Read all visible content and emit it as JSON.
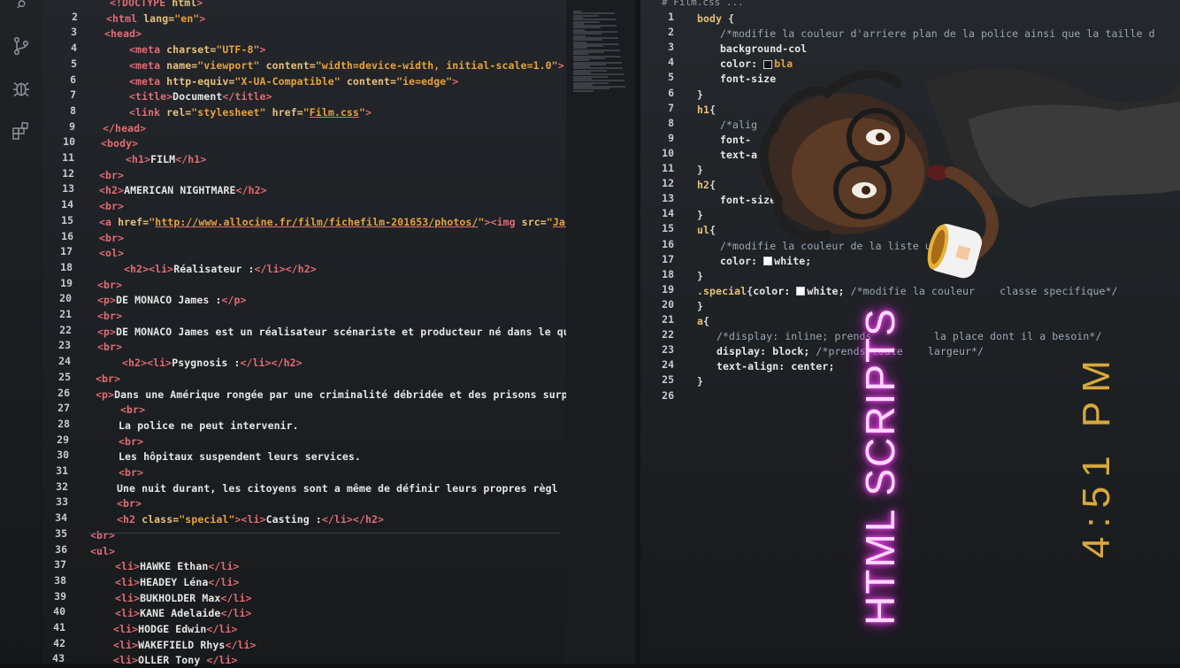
{
  "left_editor": {
    "lines": [
      {
        "n": "",
        "html": "<span class='tok-tag'>&lt;!DOCTYPE</span> <span class='tok-attr'>html</span><span class='tok-tag'>&gt;</span>",
        "indent": 124
      },
      {
        "n": "2",
        "html": "<span class='tok-tag'>&lt;html</span> <span class='tok-attr'>lang=</span><span class='tok-str'>\"en\"</span><span class='tok-tag'>&gt;</span>",
        "indent": 120
      },
      {
        "n": "3",
        "html": "<span class='tok-tag'>&lt;head&gt;</span>",
        "indent": 118
      },
      {
        "n": "4",
        "html": "<span class='tok-tag'>&lt;meta</span> <span class='tok-attr'>charset=</span><span class='tok-str'>\"UTF-8\"</span><span class='tok-tag'>&gt;</span>",
        "indent": 146
      },
      {
        "n": "5",
        "html": "<span class='tok-tag'>&lt;meta</span> <span class='tok-attr'>name=</span><span class='tok-str'>\"viewport\"</span> <span class='tok-attr'>content=</span><span class='tok-str'>\"width=device-width, initial-scale=1.0\"</span><span class='tok-tag'>&gt;</span>",
        "indent": 146
      },
      {
        "n": "6",
        "html": "<span class='tok-tag'>&lt;meta</span> <span class='tok-attr'>http-equiv=</span><span class='tok-str'>\"X-UA-Compatible\"</span> <span class='tok-attr'>content=</span><span class='tok-str'>\"ie=edge\"</span><span class='tok-tag'>&gt;</span>",
        "indent": 146
      },
      {
        "n": "7",
        "html": "<span class='tok-tag'>&lt;title&gt;</span><span class='tok-text'>Document</span><span class='tok-tag'>&lt;/title&gt;</span>",
        "indent": 146
      },
      {
        "n": "8",
        "html": "<span class='tok-tag'>&lt;link</span> <span class='tok-attr'>rel=</span><span class='tok-str'>\"stylesheet\"</span> <span class='tok-attr'>href=</span><span class='tok-str'>\"<span class='tok-link'>Film.css</span>\"</span><span class='tok-tag'>&gt;</span>",
        "indent": 146
      },
      {
        "n": "9",
        "html": "<span class='tok-tag'>&lt;/head&gt;</span>",
        "indent": 116
      },
      {
        "n": "10",
        "html": "<span class='tok-tag'>&lt;body&gt;</span>",
        "indent": 114
      },
      {
        "n": "11",
        "html": "<span class='tok-tag'>&lt;h1&gt;</span><span class='tok-text'>FILM</span><span class='tok-tag'>&lt;/h1&gt;</span>",
        "indent": 142
      },
      {
        "n": "12",
        "html": "<span class='tok-tag'>&lt;br&gt;</span>",
        "indent": 112
      },
      {
        "n": "13",
        "html": "<span class='tok-tag'>&lt;h2&gt;</span><span class='tok-text'>AMERICAN NIGHTMARE</span><span class='tok-tag'>&lt;/h2&gt;</span>",
        "indent": 112
      },
      {
        "n": "14",
        "html": "<span class='tok-tag'>&lt;br&gt;</span>",
        "indent": 112
      },
      {
        "n": "15",
        "html": "<span class='tok-tag'>&lt;a</span> <span class='tok-attr'>href=</span><span class='tok-str'>\"<span class='tok-link'>http://www.allocine.fr/film/fichefilm-201653/photos/</span>\"</span><span class='tok-tag'>&gt;&lt;img</span> <span class='tok-attr'>src=</span><span class='tok-str'>\"<span class='tok-link'>Jac</span></span>",
        "indent": 112
      },
      {
        "n": "16",
        "html": "<span class='tok-tag'>&lt;br&gt;</span>",
        "indent": 112
      },
      {
        "n": "17",
        "html": "<span class='tok-tag'>&lt;ol&gt;</span>",
        "indent": 112
      },
      {
        "n": "18",
        "html": "<span class='tok-tag'>&lt;h2&gt;&lt;li&gt;</span><span class='tok-text'>Réalisateur :</span><span class='tok-tag'>&lt;/li&gt;&lt;/h2&gt;</span>",
        "indent": 140
      },
      {
        "n": "19",
        "html": "<span class='tok-tag'>&lt;br&gt;</span>",
        "indent": 110
      },
      {
        "n": "20",
        "html": "<span class='tok-tag'>&lt;p&gt;</span><span class='tok-text'>DE MONACO James :</span><span class='tok-tag'>&lt;/p&gt;</span>",
        "indent": 110
      },
      {
        "n": "21",
        "html": "<span class='tok-tag'>&lt;br&gt;</span>",
        "indent": 110
      },
      {
        "n": "22",
        "html": "<span class='tok-tag'>&lt;p&gt;</span><span class='tok-text'>DE MONACO James est un réalisateur scénariste et producteur né dans le qu</span>",
        "indent": 110
      },
      {
        "n": "23",
        "html": "<span class='tok-tag'>&lt;br&gt;</span>",
        "indent": 110
      },
      {
        "n": "24",
        "html": "<span class='tok-tag'>&lt;h2&gt;&lt;li&gt;</span><span class='tok-text'>Psygnosis :</span><span class='tok-tag'>&lt;/li&gt;&lt;/h2&gt;</span>",
        "indent": 138
      },
      {
        "n": "25",
        "html": "<span class='tok-tag'>&lt;br&gt;</span>",
        "indent": 108
      },
      {
        "n": "26",
        "html": "<span class='tok-tag'>&lt;p&gt;</span><span class='tok-text'>Dans une Amérique rongée par une criminalité débridée et des prisons surp</span>",
        "indent": 108
      },
      {
        "n": "27",
        "html": "<span class='tok-tag'>&lt;br&gt;</span>",
        "indent": 136
      },
      {
        "n": "28",
        "html": "<span class='tok-text'>La police ne peut intervenir.</span>",
        "indent": 134
      },
      {
        "n": "29",
        "html": "<span class='tok-tag'>&lt;br&gt;</span>",
        "indent": 134
      },
      {
        "n": "30",
        "html": "<span class='tok-text'>Les hôpitaux suspendent leurs services.</span>",
        "indent": 134
      },
      {
        "n": "31",
        "html": "<span class='tok-tag'>&lt;br&gt;</span>",
        "indent": 134
      },
      {
        "n": "32",
        "html": "<span class='tok-text'>Une nuit durant, les citoyens sont a même de définir leurs propres règl</span>",
        "indent": 132
      },
      {
        "n": "33",
        "html": "<span class='tok-tag'>&lt;br&gt;</span>",
        "indent": 132
      },
      {
        "n": "34",
        "html": "<span class='tok-tag'>&lt;h2</span> <span class='tok-attr'>class=</span><span class='tok-str'>\"special\"</span><span class='tok-tag'>&gt;&lt;li&gt;</span><span class='tok-text'>Casting :</span><span class='tok-tag'>&lt;/li&gt;&lt;/h2&gt;</span>",
        "indent": 132
      },
      {
        "n": "35",
        "html": "<span class='tok-tag'>&lt;br&gt;</span>",
        "indent": 102
      },
      {
        "n": "36",
        "html": "<span class='tok-tag'>&lt;ul&gt;</span>",
        "indent": 102
      },
      {
        "n": "37",
        "html": "<span class='tok-tag'>&lt;li&gt;</span><span class='tok-text'>HAWKE Ethan</span><span class='tok-tag'>&lt;/li&gt;</span>",
        "indent": 130
      },
      {
        "n": "38",
        "html": "<span class='tok-tag'>&lt;li&gt;</span><span class='tok-text'>HEADEY Léna</span><span class='tok-tag'>&lt;/li&gt;</span>",
        "indent": 130
      },
      {
        "n": "39",
        "html": "<span class='tok-tag'>&lt;li&gt;</span><span class='tok-text'>BUKHOLDER Max</span><span class='tok-tag'>&lt;/li&gt;</span>",
        "indent": 130
      },
      {
        "n": "40",
        "html": "<span class='tok-tag'>&lt;li&gt;</span><span class='tok-text'>KANE Adelaide</span><span class='tok-tag'>&lt;/li&gt;</span>",
        "indent": 130
      },
      {
        "n": "41",
        "html": "<span class='tok-tag'>&lt;li&gt;</span><span class='tok-text'>HODGE Edwin</span><span class='tok-tag'>&lt;/li&gt;</span>",
        "indent": 128
      },
      {
        "n": "42",
        "html": "<span class='tok-tag'>&lt;li&gt;</span><span class='tok-text'>WAKEFIELD Rhys</span><span class='tok-tag'>&lt;/li&gt;</span>",
        "indent": 128
      },
      {
        "n": "43",
        "html": "<span class='tok-tag'>&lt;li&gt;</span><span class='tok-text'>OLLER Tony </span><span class='tok-tag'>&lt;/li&gt;</span>",
        "indent": 128
      }
    ]
  },
  "right_editor": {
    "tab_title": "#  Film.css   ...",
    "lines": [
      {
        "n": "1",
        "html": "<span class='tok-sel'>body</span> <span class='tok-punct'>{</span>",
        "indent": 788
      },
      {
        "n": "2",
        "html": "<span class='tok-comment'>/*modifie la couleur d'arriere plan de la police ainsi que la taille d</span>",
        "indent": 814
      },
      {
        "n": "3",
        "html": "<span class='tok-prop'>background-col</span>",
        "indent": 814
      },
      {
        "n": "4",
        "html": "<span class='tok-prop'>color:</span> <span class='swatch' style='background:#111'></span><span class='tok-str'>bla</span>",
        "indent": 814
      },
      {
        "n": "5",
        "html": "<span class='tok-prop'>font-size</span>",
        "indent": 814
      },
      {
        "n": "6",
        "html": "<span class='tok-punct'>}</span>",
        "indent": 788
      },
      {
        "n": "7",
        "html": "<span class='tok-sel'>h1</span><span class='tok-punct'>{</span>",
        "indent": 788
      },
      {
        "n": "8",
        "html": "<span class='tok-comment'>/*alig</span>",
        "indent": 814
      },
      {
        "n": "9",
        "html": "<span class='tok-prop'>font-</span>",
        "indent": 814
      },
      {
        "n": "10",
        "html": "<span class='tok-prop'>text-a</span>",
        "indent": 814
      },
      {
        "n": "11",
        "html": "<span class='tok-punct'>}</span>",
        "indent": 788
      },
      {
        "n": "12",
        "html": "<span class='tok-sel'>h2</span><span class='tok-punct'>{</span>",
        "indent": 788
      },
      {
        "n": "13",
        "html": "<span class='tok-prop'>font-size:</span>",
        "indent": 814
      },
      {
        "n": "14",
        "html": "<span class='tok-punct'>}</span>",
        "indent": 788
      },
      {
        "n": "15",
        "html": "<span class='tok-sel'>ul</span><span class='tok-punct'>{</span>",
        "indent": 788
      },
      {
        "n": "16",
        "html": "<span class='tok-comment'>/*modifie la couleur de la liste ul*/</span>",
        "indent": 814
      },
      {
        "n": "17",
        "html": "<span class='tok-prop'>color:</span> <span class='swatch' style='background:#fff'></span><span class='tok-text'>white;</span>",
        "indent": 814
      },
      {
        "n": "18",
        "html": "<span class='tok-punct'>}</span>",
        "indent": 788
      },
      {
        "n": "19",
        "html": "<span class='tok-sel'>.special</span><span class='tok-punct'>{</span><span class='tok-prop'>color:</span> <span class='swatch' style='background:#fff'></span><span class='tok-text'>white;</span> <span class='tok-comment'>/*modifie la couleur    classe specifique*/</span>",
        "indent": 788
      },
      {
        "n": "20",
        "html": "<span class='tok-punct'>}</span>",
        "indent": 788
      },
      {
        "n": "21",
        "html": "<span class='tok-sel'>a</span><span class='tok-punct'>{</span>",
        "indent": 788
      },
      {
        "n": "22",
        "html": "<span class='tok-comment'>/*display: inline; prends          la place dont il a besoin*/</span>",
        "indent": 810
      },
      {
        "n": "23",
        "html": "<span class='tok-prop'>display:</span> <span class='tok-text'>block;</span> <span class='tok-comment'>/*prends toute    largeur*/</span>",
        "indent": 810
      },
      {
        "n": "24",
        "html": "<span class='tok-prop'>text-align:</span> <span class='tok-text'>center;</span>",
        "indent": 810
      },
      {
        "n": "25",
        "html": "<span class='tok-punct'>}</span>",
        "indent": 788
      },
      {
        "n": "26",
        "html": "",
        "indent": 788
      }
    ]
  },
  "overlay": {
    "caption": "HTML SCRIPTS",
    "time": "4:51 PM"
  },
  "icons": [
    "search-icon",
    "source-control-icon",
    "debug-icon",
    "extensions-icon"
  ]
}
